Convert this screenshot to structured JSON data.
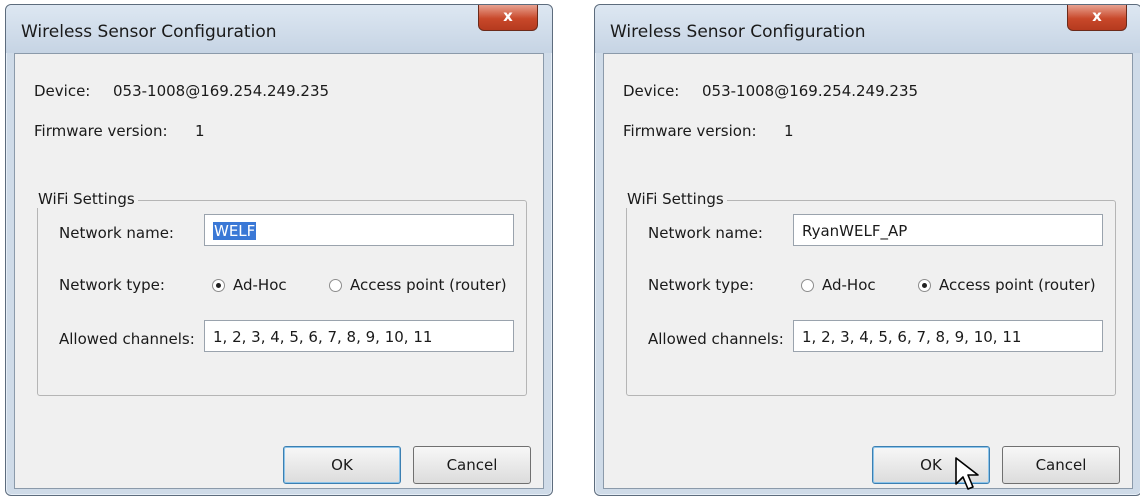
{
  "left": {
    "title": "Wireless Sensor Configuration",
    "close_glyph": "x",
    "device_label": "Device:",
    "device_value": "053-1008@169.254.249.235",
    "firmware_label": "Firmware version:",
    "firmware_value": "1",
    "group_title": "WiFi Settings",
    "network_name_label": "Network name:",
    "network_name_value": "WELF",
    "network_type_label": "Network type:",
    "radio_adhoc": "Ad-Hoc",
    "radio_ap": "Access point (router)",
    "selected_type": "Ad-Hoc",
    "allowed_channels_label": "Allowed channels:",
    "allowed_channels_value": "1, 2, 3, 4, 5, 6, 7, 8, 9, 10, 11",
    "ok": "OK",
    "cancel": "Cancel"
  },
  "right": {
    "title": "Wireless Sensor Configuration",
    "close_glyph": "x",
    "device_label": "Device:",
    "device_value": "053-1008@169.254.249.235",
    "firmware_label": "Firmware version:",
    "firmware_value": "1",
    "group_title": "WiFi Settings",
    "network_name_label": "Network name:",
    "network_name_value": "RyanWELF_AP",
    "network_type_label": "Network type:",
    "radio_adhoc": "Ad-Hoc",
    "radio_ap": "Access point (router)",
    "selected_type": "Access point (router)",
    "allowed_channels_label": "Allowed channels:",
    "allowed_channels_value": "1, 2, 3, 4, 5, 6, 7, 8, 9, 10, 11",
    "ok": "OK",
    "cancel": "Cancel"
  }
}
